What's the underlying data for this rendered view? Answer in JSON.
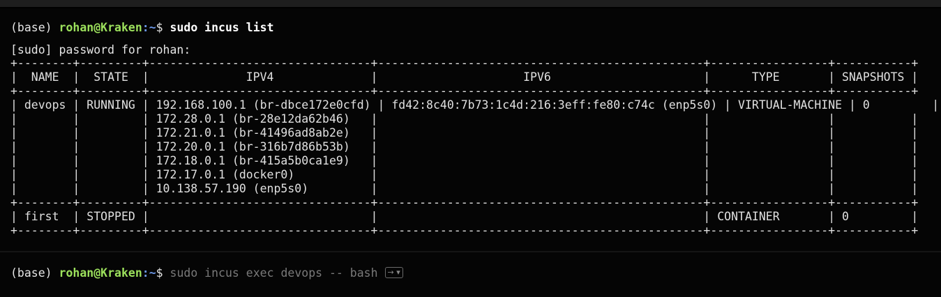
{
  "terminal": {
    "command_prompt": {
      "env": "(base) ",
      "user_host": "rohan@Kraken",
      "colon": ":",
      "path": "~",
      "dollar": "$ ",
      "command": "sudo incus list"
    },
    "sudo_prompt": "[sudo] password for rohan:",
    "table_lines": [
      "+--------+---------+--------------------------------+-----------------------------------------------+-----------------+-----------+",
      "|  NAME  |  STATE  |              IPV4              |                     IPV6                      |      TYPE       | SNAPSHOTS |",
      "+--------+---------+--------------------------------+-----------------------------------------------+-----------------+-----------+",
      "| devops | RUNNING | 192.168.100.1 (br-dbce172e0cfd) | fd42:8c40:7b73:1c4d:216:3eff:fe80:c74c (enp5s0) | VIRTUAL-MACHINE | 0         |",
      "|        |         | 172.28.0.1 (br-28e12da62b46)   |                                               |                 |           |",
      "|        |         | 172.21.0.1 (br-41496ad8ab2e)   |                                               |                 |           |",
      "|        |         | 172.20.0.1 (br-316b7d86b53b)   |                                               |                 |           |",
      "|        |         | 172.18.0.1 (br-415a5b0ca1e9)   |                                               |                 |           |",
      "|        |         | 172.17.0.1 (docker0)           |                                               |                 |           |",
      "|        |         | 10.138.57.190 (enp5s0)         |                                               |                 |           |",
      "+--------+---------+--------------------------------+-----------------------------------------------+-----------------+-----------+",
      "| first  | STOPPED |                                |                                               | CONTAINER       | 0         |",
      "+--------+---------+--------------------------------+-----------------------------------------------+-----------------+-----------+"
    ],
    "input_prompt": {
      "env": "(base) ",
      "user_host": "rohan@Kraken",
      "colon": ":",
      "path": "~",
      "dollar": "$ ",
      "typed_suggestion": "sudo incus exec devops -- bash",
      "accept_hint": "→ ▾"
    }
  },
  "colors": {
    "background": "#000000",
    "user_host": "#9ce05c",
    "path": "#6c98e8",
    "suggestion": "#7a7a7a"
  }
}
